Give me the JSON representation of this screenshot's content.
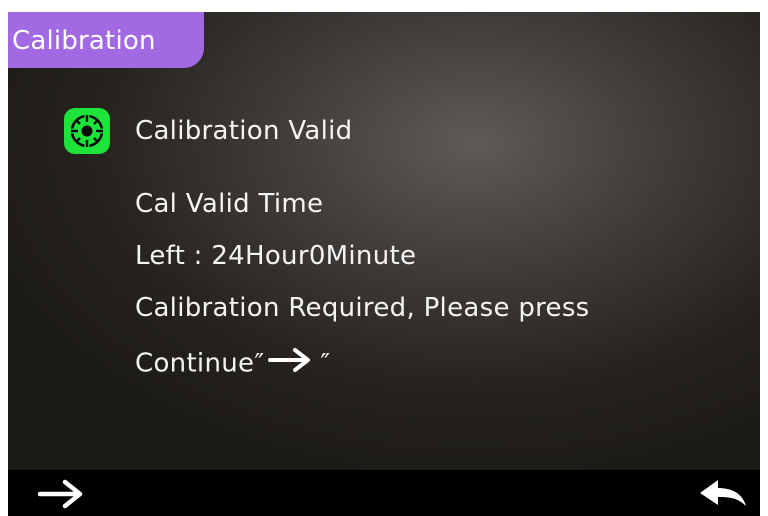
{
  "header": {
    "title": "Calibration"
  },
  "status": {
    "icon": "calibration-target-icon",
    "icon_color": "#1ee33a",
    "text": "Calibration Valid"
  },
  "message": {
    "valid_time_label": "Cal Valid Time",
    "time_left_prefix": "Left : ",
    "time_left_value": "24Hour0Minute",
    "required_text": "Calibration Required, Please press",
    "continue_prefix": "Continue",
    "quote_open": "″",
    "quote_close": "″",
    "inline_icon": "right-arrow-icon"
  },
  "toolbar": {
    "next_icon": "right-arrow-icon",
    "back_icon": "return-arrow-icon"
  },
  "colors": {
    "title_tab": "#a26ae2",
    "text": "#f4f4f4",
    "status_green": "#1ee33a",
    "bottom_bar": "#000000"
  }
}
